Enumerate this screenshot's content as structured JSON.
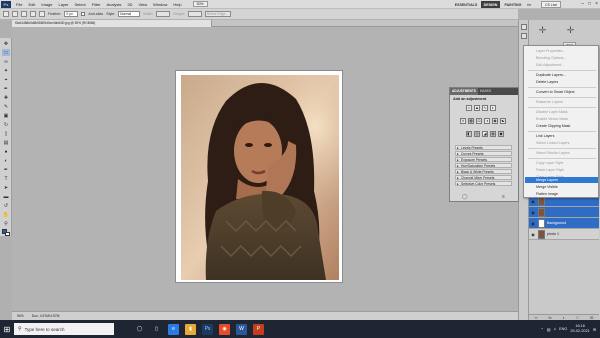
{
  "app": {
    "logo": "Ps"
  },
  "menubar": {
    "items": [
      "File",
      "Edit",
      "Image",
      "Layer",
      "Select",
      "Filter",
      "Analysis",
      "3D",
      "View",
      "Window",
      "Help"
    ],
    "zoom": "50%"
  },
  "workspaces": {
    "essentials": "ESSENTIALS",
    "design": "DESIGN",
    "painting": "PAINTING",
    "more": ">>",
    "cslive": "CS Live"
  },
  "options": {
    "feather_label": "Feather:",
    "feather_value": "0 px",
    "antialias_label": "Anti-alias",
    "style_label": "Style:",
    "style_value": "Normal",
    "width_label": "Width:",
    "height_label": "Height:",
    "refine_label": "Refine Edge..."
  },
  "document": {
    "tab_title": "f3d44486b5d6b5580540ce4bb84f0.jpg @ 50% (RGB/8#)",
    "zoom": "50%",
    "doc_info": "Doc: 4.57M/4.57M"
  },
  "context_menu": {
    "items": [
      {
        "label": "Layer Properties...",
        "enabled": false
      },
      {
        "label": "Blending Options...",
        "enabled": false
      },
      {
        "label": "Edit Adjustment...",
        "enabled": false
      },
      {
        "label": "Duplicate Layers...",
        "enabled": true
      },
      {
        "label": "Delete Layers",
        "enabled": true
      },
      {
        "label": "Convert to Smart Object",
        "enabled": true
      },
      {
        "label": "Rasterize Layers",
        "enabled": false
      },
      {
        "label": "Disable Layer Mask",
        "enabled": false
      },
      {
        "label": "Enable Vector Mask",
        "enabled": false
      },
      {
        "label": "Create Clipping Mask",
        "enabled": true
      },
      {
        "label": "Link Layers",
        "enabled": true
      },
      {
        "label": "Select Linked Layers",
        "enabled": false
      },
      {
        "label": "Select Similar Layers",
        "enabled": false
      },
      {
        "label": "Copy Layer Style",
        "enabled": false
      },
      {
        "label": "Paste Layer Style",
        "enabled": false
      },
      {
        "label": "Clear Layer Style",
        "enabled": false
      },
      {
        "label": "Merge Layers",
        "enabled": true,
        "highlighted": true
      },
      {
        "label": "Merge Visible",
        "enabled": true
      },
      {
        "label": "Flatten Image",
        "enabled": true
      }
    ]
  },
  "adjustments": {
    "tabs": [
      "ADJUSTMENTS",
      "MASKS"
    ],
    "title": "Add an adjustment",
    "presets": [
      "Levels Presets",
      "Curves Presets",
      "Exposure Presets",
      "Hue/Saturation Presets",
      "Black & White Presets",
      "Channel Mixer Presets",
      "Selective Color Presets"
    ]
  },
  "layers": [
    {
      "name": "",
      "selected": true
    },
    {
      "name": "",
      "selected": true
    },
    {
      "name": "Background",
      "selected": true
    },
    {
      "name": "photo 1",
      "selected": false
    }
  ],
  "taskbar": {
    "search_placeholder": "Type here to search",
    "lang": "ENG",
    "time": "16:16",
    "date": "25-02-2021"
  }
}
